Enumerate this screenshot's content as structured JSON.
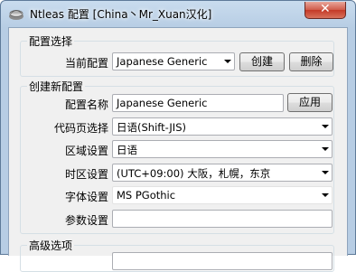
{
  "window": {
    "title": "Ntleas 配置 [China丶Mr_Xuan汉化]"
  },
  "config_select": {
    "legend": "配置选择",
    "current_label": "当前配置",
    "current_value": "Japanese Generic",
    "create_button": "创建",
    "delete_button": "删除"
  },
  "create_config": {
    "legend": "创建新配置",
    "name_label": "配置名称",
    "name_value": "Japanese Generic",
    "apply_button": "应用",
    "codepage_label": "代码页选择",
    "codepage_value": "日语(Shift-JIS)",
    "locale_label": "区域设置",
    "locale_value": "日语",
    "timezone_label": "时区设置",
    "timezone_value": "(UTC+09:00) 大阪，札幌，东京",
    "font_label": "字体设置",
    "font_value": "MS PGothic",
    "params_label": "参数设置",
    "params_value": ""
  },
  "advanced": {
    "legend": "高级选项"
  }
}
